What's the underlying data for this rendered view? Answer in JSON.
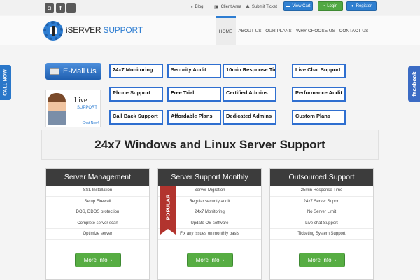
{
  "topbar": {
    "social": [
      {
        "icon": "instagram-icon",
        "glyph": "◘"
      },
      {
        "icon": "facebook-icon",
        "glyph": "f"
      },
      {
        "icon": "google-plus-icon",
        "glyph": "+"
      }
    ],
    "links": [
      {
        "label": "Blog",
        "icon": "chat-icon",
        "glyph": "💬"
      },
      {
        "label": "Client Area",
        "icon": "monitor-icon",
        "glyph": "▣"
      },
      {
        "label": "Submit Ticket",
        "icon": "gear-icon",
        "glyph": "✱"
      }
    ],
    "buttons": {
      "view_cart": "View Cart",
      "login": "Login",
      "register": "Register"
    }
  },
  "header": {
    "logo_part1": "iSERVER",
    "logo_part2": " SUPPORT",
    "nav": [
      "HOME",
      "ABOUT US",
      "OUR PLANS",
      "WHY CHOOSE US",
      "CONTACT US"
    ],
    "active_nav": "HOME"
  },
  "side": {
    "call_now": "CALL NOW",
    "facebook": "facebook"
  },
  "banner": {
    "email_label": "E-Mail Us",
    "live_title": "Live",
    "live_sub": "SUPPORT",
    "chat_now": "Chat Now!",
    "services": [
      [
        "24x7 Monitoring",
        "Security Audit",
        "10min Response Time",
        "Live Chat Support"
      ],
      [
        "Phone Support",
        "Free Trial",
        "Certified Admins",
        "Performance Audit"
      ],
      [
        "Call Back Support",
        "Affordable Plans",
        "Dedicated Admins",
        "Custom Plans"
      ]
    ]
  },
  "main_title": "24x7 Windows and Linux Server Support",
  "plans": [
    {
      "title": "Server Management",
      "features": [
        "SSL Installation",
        "Setup Firewall",
        "DOS, DDOS protection",
        "Complete server scan",
        "Optimize server"
      ],
      "button": "More Info"
    },
    {
      "title": "Server Support Monthly",
      "ribbon": "POPULAR",
      "features": [
        "Server Migration",
        "Regular security audit",
        "24x7 Monitoring",
        "Update OS software",
        "Fix any issues on monthly basis"
      ],
      "button": "More Info"
    },
    {
      "title": "Outsourced Support",
      "features": [
        "25min Response Time",
        "24x7 Server Suport",
        "No Server Limit",
        "Live chat Support",
        "Ticketing System Support"
      ],
      "button": "More Info"
    }
  ],
  "colors": {
    "accent": "#2d7dd2",
    "green": "#57ad43",
    "ribbon": "#b2342e",
    "panel_header": "#3c3c3c"
  }
}
